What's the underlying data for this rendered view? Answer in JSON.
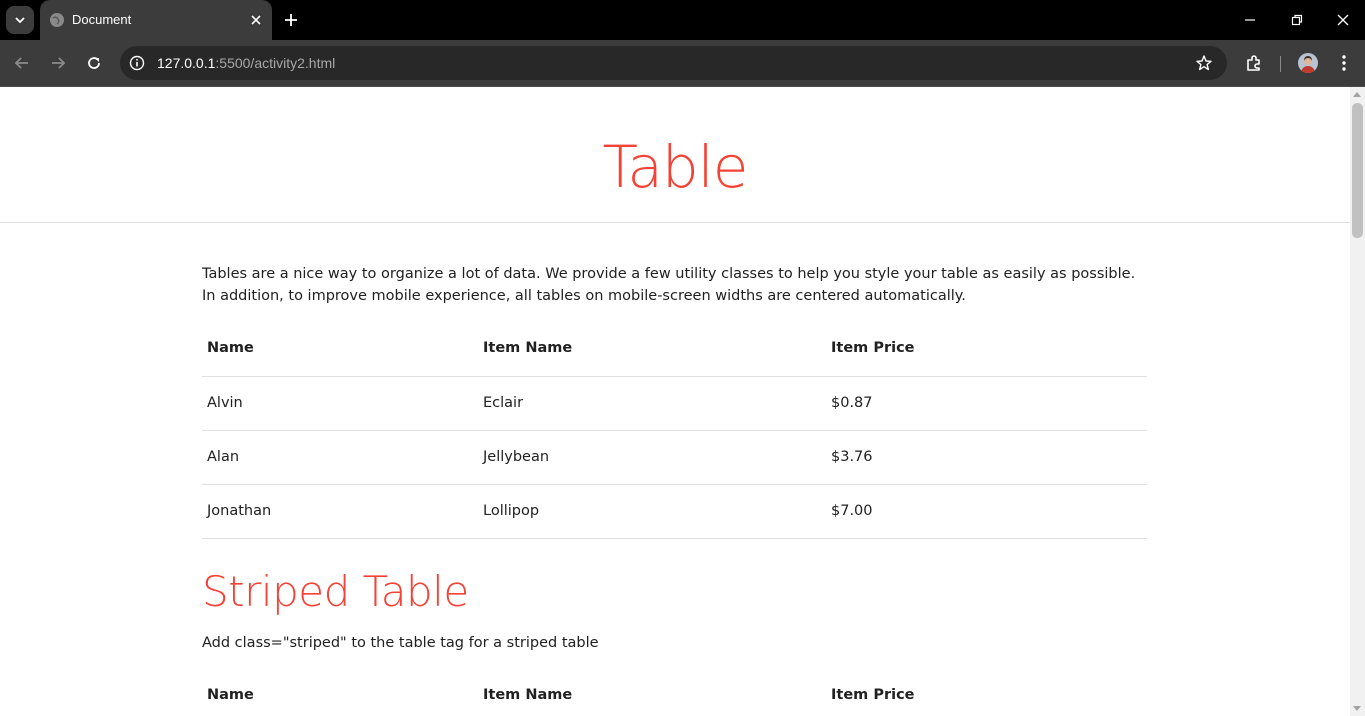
{
  "browser": {
    "tab_title": "Document",
    "url_host": "127.0.0.1",
    "url_rest": ":5500/activity2.html"
  },
  "page": {
    "title": "Table",
    "intro": "Tables are a nice way to organize a lot of data. We provide a few utility classes to help you style your table as easily as possible. In addition, to improve mobile experience, all tables on mobile-screen widths are centered automatically.",
    "table1": {
      "headers": [
        "Name",
        "Item Name",
        "Item Price"
      ],
      "rows": [
        [
          "Alvin",
          "Eclair",
          "$0.87"
        ],
        [
          "Alan",
          "Jellybean",
          "$3.76"
        ],
        [
          "Jonathan",
          "Lollipop",
          "$7.00"
        ]
      ]
    },
    "section2": {
      "title": "Striped Table",
      "desc": "Add class=\"striped\" to the table tag for a striped table"
    },
    "table2": {
      "headers": [
        "Name",
        "Item Name",
        "Item Price"
      ]
    }
  },
  "colors": {
    "accent": "#f44336",
    "text": "#212121",
    "divider": "#e0e0e0"
  }
}
